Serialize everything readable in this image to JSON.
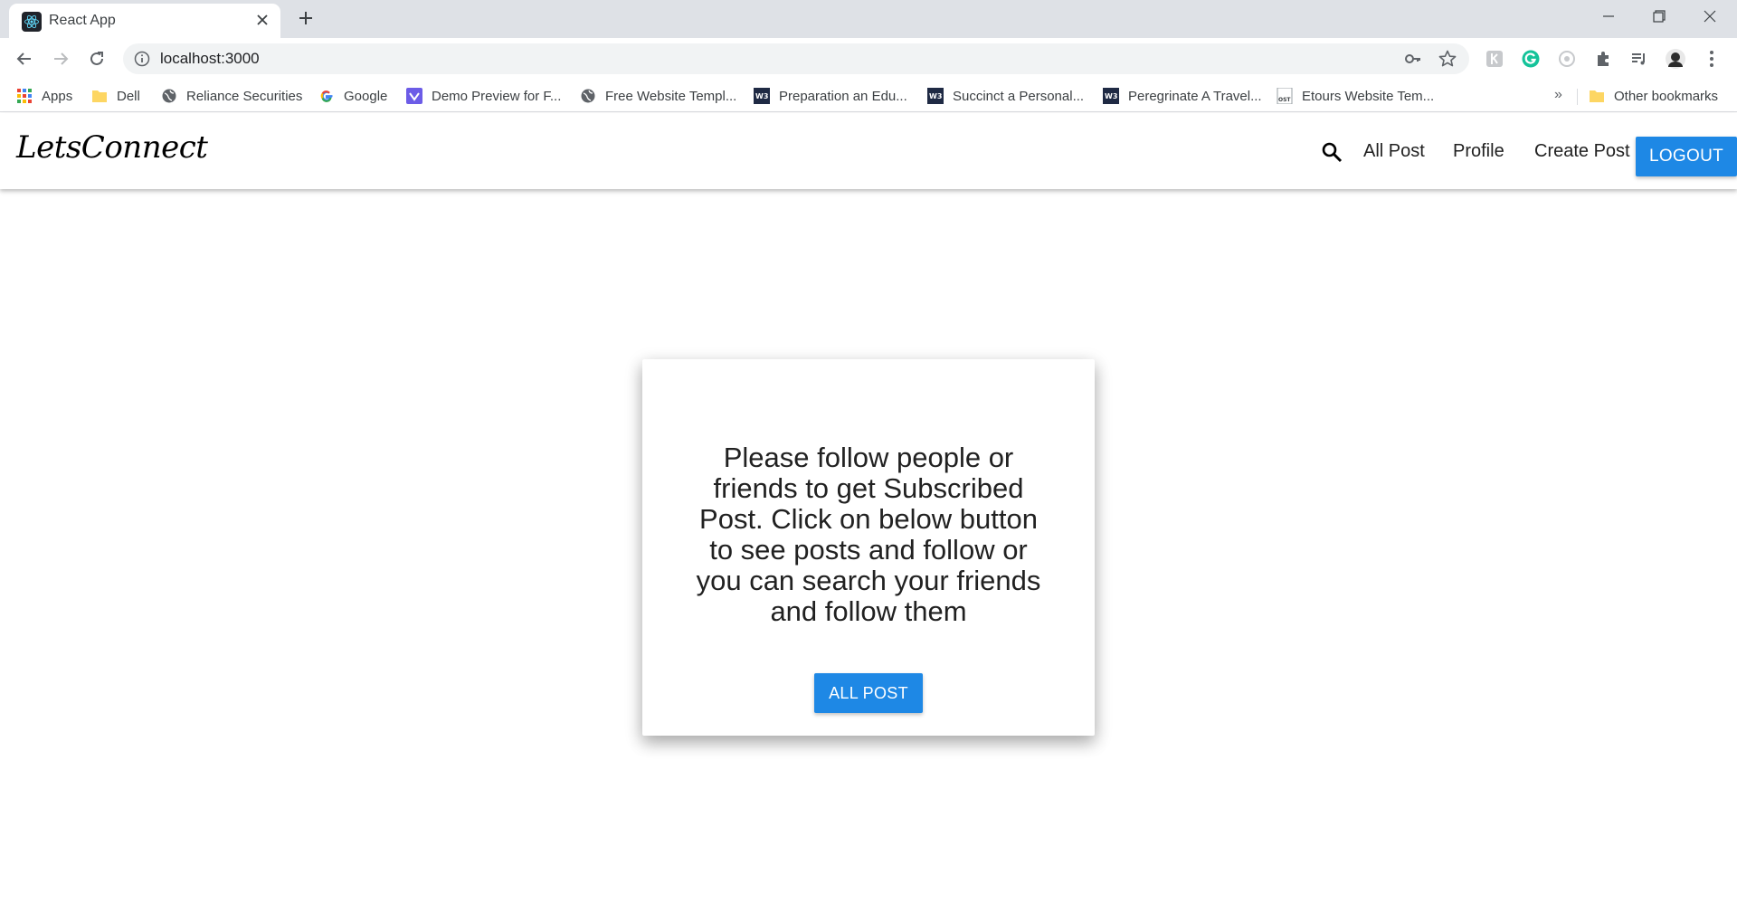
{
  "browser": {
    "tab": {
      "title": "React App"
    },
    "url": "localhost:3000",
    "bookmarks": [
      {
        "label": "Apps",
        "icon": "apps-grid-icon"
      },
      {
        "label": "Dell",
        "icon": "folder-icon"
      },
      {
        "label": "Reliance Securities",
        "icon": "globe-icon"
      },
      {
        "label": "Google",
        "icon": "google-icon"
      },
      {
        "label": "Demo Preview for F...",
        "icon": "site-icon"
      },
      {
        "label": "Free Website Templ...",
        "icon": "globe-icon"
      },
      {
        "label": "Preparation an Edu...",
        "icon": "w3-icon"
      },
      {
        "label": "Succinct a Personal...",
        "icon": "w3-icon"
      },
      {
        "label": "Peregrinate A Travel...",
        "icon": "w3-icon"
      },
      {
        "label": "Etours Website Tem...",
        "icon": "ost-icon"
      }
    ],
    "more_bookmarks": "»",
    "other_bookmarks": "Other bookmarks"
  },
  "app": {
    "brand": "LetsConnect",
    "nav": {
      "all_post": "All Post",
      "profile": "Profile",
      "create_post": "Create Post",
      "logout": "LOGOUT"
    },
    "card": {
      "message": "Please follow people or friends to get Subscribed Post. Click on below button to see posts and follow or you can search your friends and follow them",
      "button": "ALL POST"
    }
  },
  "colors": {
    "accent": "#1e88e5",
    "tabstrip": "#dee1e6",
    "omnibox": "#f1f3f4"
  }
}
